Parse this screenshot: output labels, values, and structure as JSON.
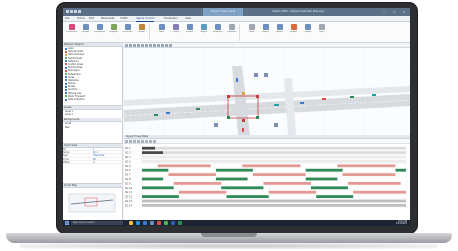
{
  "window": {
    "title": "Vissim 2022 - Signal Controller Planning",
    "context_tab": "Signal Times Table",
    "controls": "—  ▢  ✕"
  },
  "ribbon_tabs": [
    {
      "label": "File",
      "active": false
    },
    {
      "label": "Home",
      "active": false
    },
    {
      "label": "Edit",
      "active": false
    },
    {
      "label": "Base Data",
      "active": false
    },
    {
      "label": "Traffic",
      "active": false
    },
    {
      "label": "Signal Control",
      "active": true
    },
    {
      "label": "Evaluation",
      "active": false
    },
    {
      "label": "View",
      "active": false
    }
  ],
  "ribbon_buttons": [
    {
      "label": "Controllers",
      "color": "#d94a7b"
    },
    {
      "label": "Groups",
      "color": "#6b8fbf"
    },
    {
      "label": "Intergreens",
      "color": "#6b8fbf"
    },
    {
      "label": "Program",
      "color": "#7ea35a"
    },
    {
      "label": "Detectors",
      "color": "#6b8fbf"
    },
    {
      "label": "Heads",
      "color": "#c0863c"
    },
    {
      "label": "Table",
      "color": "#6b8fbf"
    },
    {
      "label": "Timing",
      "color": "#8a7ab5"
    },
    {
      "label": "Phases",
      "color": "#6b8fbf"
    },
    {
      "label": "Stages",
      "color": "#5a9ec2"
    },
    {
      "label": "Sequence",
      "color": "#6b8fbf"
    },
    {
      "label": "Compare",
      "color": "#a0a8b2"
    },
    {
      "label": "Check",
      "color": "#a0a8b2"
    },
    {
      "label": "Export",
      "color": "#6b8fbf"
    },
    {
      "label": "Import",
      "color": "#6b8fbf"
    },
    {
      "label": "Report",
      "color": "#d96a3c"
    },
    {
      "label": "Options",
      "color": "#6b8fbf"
    },
    {
      "label": "Help",
      "color": "#a0a8b2"
    }
  ],
  "left_panels": {
    "network_objects_title": "Network Objects",
    "network_objects": [
      {
        "label": "Links",
        "color": "#3b7bd1"
      },
      {
        "label": "Vehicle Inputs",
        "color": "#e14b4b"
      },
      {
        "label": "Vehicle Routes",
        "color": "#e1a64b"
      },
      {
        "label": "Signal Heads",
        "color": "#4bb35a"
      },
      {
        "label": "Detectors",
        "color": "#3b7bd1"
      },
      {
        "label": "Conflict Areas",
        "color": "#d94a7b"
      },
      {
        "label": "Priority Rules",
        "color": "#3b7bd1"
      },
      {
        "label": "Stop Signs",
        "color": "#e14b4b"
      },
      {
        "label": "Pedestrians",
        "color": "#4bb35a"
      },
      {
        "label": "Areas",
        "color": "#3b7bd1"
      },
      {
        "label": "Obstacles",
        "color": "#3b7bd1"
      },
      {
        "label": "Ramps",
        "color": "#3b7bd1"
      },
      {
        "label": "Nodes",
        "color": "#3b7bd1"
      },
      {
        "label": "Sections",
        "color": "#3b7bd1"
      },
      {
        "label": "Parking Lots",
        "color": "#3b7bd1"
      },
      {
        "label": "Public Transport",
        "color": "#4bb35a"
      },
      {
        "label": "Data Collection",
        "color": "#3b7bd1"
      },
      {
        "label": "Travel Times",
        "color": "#3b7bd1"
      },
      {
        "label": "Queue Counters",
        "color": "#3b7bd1"
      },
      {
        "label": "Static 3D Models",
        "color": "#3b7bd1"
      }
    ],
    "levels_title": "Levels",
    "levels": [
      "Level 1",
      "Level 2"
    ],
    "background_title": "Backgrounds",
    "background": [
      "Aerial",
      "Map"
    ],
    "quick_view_title": "Quick View",
    "quick_view": [
      {
        "k": "No",
        "v": "1"
      },
      {
        "k": "Name",
        "v": "SC 1"
      },
      {
        "k": "Type",
        "v": "Fixed time"
      },
      {
        "k": "Cycle",
        "v": "90"
      },
      {
        "k": "Offset",
        "v": "0"
      }
    ],
    "smart_map_title": "Smart Map"
  },
  "editor": {
    "title": "Network Editor"
  },
  "signal_times": {
    "title": "Signal Times Table",
    "rows": [
      {
        "label": "SG 1",
        "segments": [
          {
            "start": 0.0,
            "end": 0.05,
            "color": "#4a4a4a"
          },
          {
            "start": 0.05,
            "end": 1.0,
            "color": "#dcdcdc"
          }
        ]
      },
      {
        "label": "SG 2",
        "segments": [
          {
            "start": 0.0,
            "end": 0.08,
            "color": "#4a4a4a"
          },
          {
            "start": 0.08,
            "end": 1.0,
            "color": "#dcdcdc"
          }
        ]
      },
      {
        "label": "SG 3",
        "segments": [
          {
            "start": 0.0,
            "end": 1.0,
            "color": "#ececec"
          }
        ]
      },
      {
        "label": "SG 4",
        "segments": [
          {
            "start": 0.0,
            "end": 1.0,
            "color": "#ececec"
          }
        ]
      },
      {
        "label": "SG 5",
        "segments": [
          {
            "start": 0.06,
            "end": 0.26,
            "color": "#e39a93"
          },
          {
            "start": 0.38,
            "end": 0.6,
            "color": "#e39a93"
          },
          {
            "start": 0.74,
            "end": 0.96,
            "color": "#e39a93"
          }
        ]
      },
      {
        "label": "SG 6",
        "segments": [
          {
            "start": 0.0,
            "end": 0.1,
            "color": "#2e8b57"
          },
          {
            "start": 0.28,
            "end": 0.42,
            "color": "#2e8b57"
          },
          {
            "start": 0.62,
            "end": 0.76,
            "color": "#2e8b57"
          },
          {
            "start": 0.96,
            "end": 1.0,
            "color": "#2e8b57"
          }
        ]
      },
      {
        "label": "SG 7",
        "segments": [
          {
            "start": 0.1,
            "end": 0.28,
            "color": "#e39a93"
          },
          {
            "start": 0.42,
            "end": 0.62,
            "color": "#e39a93"
          },
          {
            "start": 0.76,
            "end": 0.96,
            "color": "#e39a93"
          }
        ]
      },
      {
        "label": "SG 8",
        "segments": [
          {
            "start": 0.0,
            "end": 0.08,
            "color": "#2e8b57"
          },
          {
            "start": 0.28,
            "end": 0.4,
            "color": "#2e8b57"
          },
          {
            "start": 0.62,
            "end": 0.74,
            "color": "#2e8b57"
          }
        ]
      },
      {
        "label": "SG 9",
        "segments": [
          {
            "start": 0.12,
            "end": 0.3,
            "color": "#e39a93"
          },
          {
            "start": 0.46,
            "end": 0.64,
            "color": "#e39a93"
          },
          {
            "start": 0.78,
            "end": 0.98,
            "color": "#e39a93"
          }
        ]
      },
      {
        "label": "SG 10",
        "segments": [
          {
            "start": 0.0,
            "end": 0.12,
            "color": "#2e8b57"
          },
          {
            "start": 0.3,
            "end": 0.46,
            "color": "#2e8b57"
          },
          {
            "start": 0.64,
            "end": 0.78,
            "color": "#2e8b57"
          }
        ]
      },
      {
        "label": "SG 11",
        "segments": [
          {
            "start": 0.14,
            "end": 0.32,
            "color": "#e39a93"
          },
          {
            "start": 0.48,
            "end": 0.66,
            "color": "#e39a93"
          },
          {
            "start": 0.8,
            "end": 1.0,
            "color": "#e39a93"
          }
        ]
      },
      {
        "label": "SG 12",
        "segments": [
          {
            "start": 0.0,
            "end": 0.14,
            "color": "#2e8b57"
          },
          {
            "start": 0.32,
            "end": 0.48,
            "color": "#2e8b57"
          },
          {
            "start": 0.66,
            "end": 0.8,
            "color": "#2e8b57"
          }
        ]
      },
      {
        "label": "SG 13",
        "segments": [
          {
            "start": 0.0,
            "end": 1.0,
            "color": "#bfbfbf"
          }
        ]
      },
      {
        "label": "SG 14",
        "segments": [
          {
            "start": 0.0,
            "end": 1.0,
            "color": "#bfbfbf"
          }
        ]
      }
    ]
  },
  "taskbar": {
    "search_placeholder": "Type here to search",
    "time": "9:41 AM",
    "date": "3/14/2022",
    "apps": [
      {
        "name": "file-explorer-icon",
        "color": "#f0c040"
      },
      {
        "name": "edge-icon",
        "color": "#2f8fd8"
      },
      {
        "name": "mail-icon",
        "color": "#3b7bd1"
      },
      {
        "name": "store-icon",
        "color": "#6b8fbf"
      },
      {
        "name": "vissim-icon",
        "color": "#e14b4b"
      },
      {
        "name": "chrome-icon",
        "color": "#4bb35a"
      },
      {
        "name": "word-icon",
        "color": "#2b5fb0"
      },
      {
        "name": "excel-icon",
        "color": "#2e8b57"
      }
    ]
  }
}
